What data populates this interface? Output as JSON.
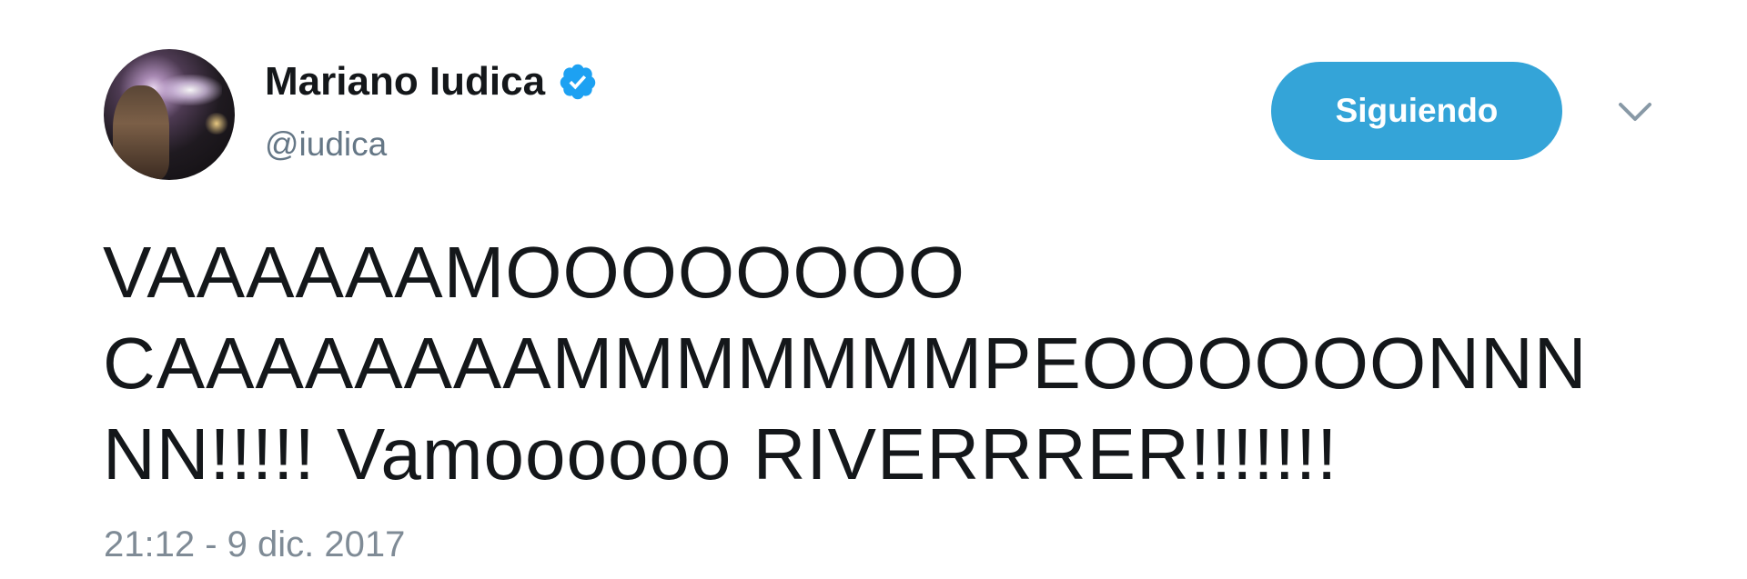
{
  "author": {
    "display_name": "Mariano Iudica",
    "handle": "@iudica",
    "verified": true,
    "avatar_icon": "profile-photo"
  },
  "actions": {
    "follow_label": "Siguiendo",
    "menu_icon": "chevron-down-icon"
  },
  "tweet": {
    "lines": [
      "VAAAAAAMOOOOOOOO",
      "CAAAAAAAAMMMMMMMPEOOOOOONNN",
      "NN!!!!! Vamoooooo RIVERRRER!!!!!!!"
    ],
    "timestamp": "21:12 - 9 dic. 2017"
  },
  "colors": {
    "follow_button": "#34a4d8",
    "verified_badge": "#1da1f2",
    "secondary_text": "#657786",
    "primary_text": "#14171a"
  }
}
